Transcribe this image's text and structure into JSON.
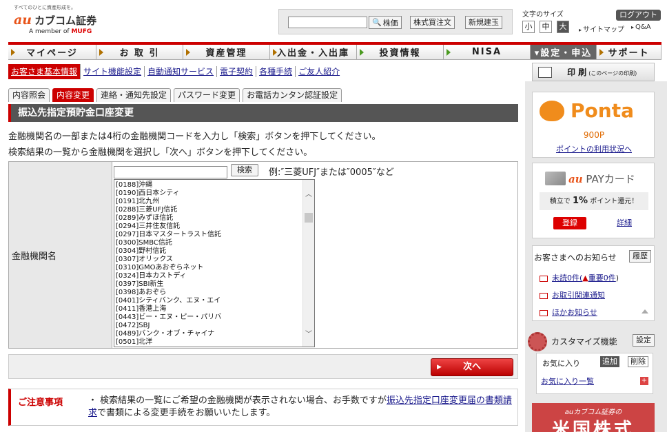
{
  "header": {
    "tagline": "すべてのひとに資産形成を。",
    "logo_au": "au",
    "logo_text": "カブコム証券",
    "member_prefix": "A member of",
    "member_brand": "MUFG",
    "search_value": "",
    "search_button": "株価",
    "buttons": [
      "株式買注文",
      "新規建玉"
    ],
    "fontsize_label": "文字のサイズ",
    "fontsizes": [
      "小",
      "中",
      "大"
    ],
    "logout": "ログアウト",
    "links": [
      "サイトマップ",
      "Q&A"
    ]
  },
  "mainnav": [
    "マイページ",
    "お 取 引",
    "資産管理",
    "入出金・入出庫",
    "投資情報",
    "NISA",
    "▾設定・申込",
    "サポート"
  ],
  "subnav": [
    "お客さま基本情報",
    "サイト機能設定",
    "自動通知サービス",
    "電子契約",
    "各種手続",
    "ご友人紹介"
  ],
  "print": {
    "label": "印 刷",
    "sub": "(このページの印刷)"
  },
  "tabs": [
    "内容照会",
    "内容変更",
    "連絡・通知先設定",
    "パスワード変更",
    "お電話カンタン認証設定"
  ],
  "section_title": "振込先指定預貯金口座変更",
  "instructions": [
    "金融機関名の一部または4桁の金融機関コードを入力し「検索」ボタンを押下してください。",
    "検索結果の一覧から金融機関を選択し「次へ」ボタンを押下してください。"
  ],
  "form": {
    "label": "金融機関名",
    "search_button": "検索",
    "example": "例:″三菱UFJ″または″0005″など",
    "banks": [
      "[0188]沖縄",
      "[0190]西日本シティ",
      "[0191]北九州",
      "[0288]三菱UFJ信託",
      "[0289]みずほ信託",
      "[0294]三井住友信託",
      "[0297]日本マスタートラスト信託",
      "[0300]SMBC信託",
      "[0304]野村信託",
      "[0307]オリックス",
      "[0310]GMOあおぞらネット",
      "[0324]日本カストディ",
      "[0397]SBI新生",
      "[0398]あおぞら",
      "[0401]シティバンク、エヌ・エイ",
      "[0411]香港上海",
      "[0443]ビー・エヌ・ピー・パリバ",
      "[0472]SBJ",
      "[0489]バンク・オブ・チャイナ",
      "[0501]北洋"
    ]
  },
  "next_button": "次へ",
  "notice": {
    "title": "ご注意事項",
    "text_before": "・ 検索結果の一覧にご希望の金融機関が表示されない場合、お手数ですが",
    "link": "振込先指定口座変更届の書類請求",
    "text_after": "で書類による変更手続をお願いいたします。"
  },
  "side": {
    "ponta_brand": "Ponta",
    "ponta_points": "900P",
    "ponta_link": "ポイントの利用状況へ",
    "pay_au": "au",
    "pay_brand": "PAYカード",
    "pay_rate_prefix": "積立で",
    "pay_rate": "1%",
    "pay_rate_suffix": "ポイント還元！",
    "pay_register": "登録",
    "pay_detail": "詳細",
    "notify_title": "お客さまへのお知らせ",
    "notify_history": "履歴",
    "unread": "未読0件(",
    "important": "重要0件",
    "unread_close": ")",
    "notify_link2": "お取引関連通知",
    "notify_link3": "ほかお知らせ",
    "custom_title": "カスタマイズ機能",
    "custom_setting": "設定",
    "fav_label": "お気に入り",
    "fav_add": "追加",
    "fav_delete": "削除",
    "fav_list": "お気に入り一覧",
    "banner_top": "auカブコム証券の",
    "banner_main": "米国株式"
  },
  "colors": {
    "accent": "#cc0000",
    "ponta": "#f08c1c",
    "au": "#e8541a"
  }
}
